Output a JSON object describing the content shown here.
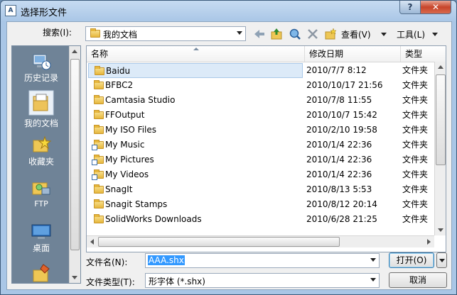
{
  "window": {
    "title": "选择形文件",
    "icon_text": "A",
    "help": "?",
    "close": "✕"
  },
  "toolbar": {
    "search_label": "搜索(I):",
    "location": "我的文档",
    "view_label": "查看(V)",
    "tools_label": "工具(L)"
  },
  "places": [
    {
      "label": "历史记录",
      "icon": "history-icon"
    },
    {
      "label": "我的文档",
      "icon": "my-documents-icon"
    },
    {
      "label": "收藏夹",
      "icon": "favorites-icon"
    },
    {
      "label": "FTP",
      "icon": "ftp-icon"
    },
    {
      "label": "桌面",
      "icon": "desktop-icon"
    },
    {
      "label": "",
      "icon": "buzzsaw-icon"
    }
  ],
  "columns": {
    "name": "名称",
    "modified": "修改日期",
    "type": "类型"
  },
  "files": [
    {
      "name": "Baidu",
      "date": "2010/7/7 8:12",
      "type": "文件夹",
      "shortcut": false
    },
    {
      "name": "BFBC2",
      "date": "2010/10/17 21:56",
      "type": "文件夹",
      "shortcut": false
    },
    {
      "name": "Camtasia Studio",
      "date": "2010/7/8 11:55",
      "type": "文件夹",
      "shortcut": false
    },
    {
      "name": "FFOutput",
      "date": "2010/10/7 15:42",
      "type": "文件夹",
      "shortcut": false
    },
    {
      "name": "My ISO Files",
      "date": "2010/2/10 19:58",
      "type": "文件夹",
      "shortcut": false
    },
    {
      "name": "My Music",
      "date": "2010/1/4 22:36",
      "type": "文件夹",
      "shortcut": true
    },
    {
      "name": "My Pictures",
      "date": "2010/1/4 22:36",
      "type": "文件夹",
      "shortcut": true
    },
    {
      "name": "My Videos",
      "date": "2010/1/4 22:36",
      "type": "文件夹",
      "shortcut": true
    },
    {
      "name": "SnagIt",
      "date": "2010/8/13 5:53",
      "type": "文件夹",
      "shortcut": false
    },
    {
      "name": "Snagit Stamps",
      "date": "2010/8/12 20:14",
      "type": "文件夹",
      "shortcut": false
    },
    {
      "name": "SolidWorks Downloads",
      "date": "2010/6/28 21:25",
      "type": "文件夹",
      "shortcut": false
    }
  ],
  "form": {
    "filename_label": "文件名(N):",
    "filename_value": "AAA.shx",
    "filetype_label": "文件类型(T):",
    "filetype_value": "形字体 (*.shx)",
    "open_button": "打开(O)",
    "cancel_button": "取消"
  },
  "colors": {
    "accent": "#3399ff",
    "places_bg": "#6f8397"
  }
}
